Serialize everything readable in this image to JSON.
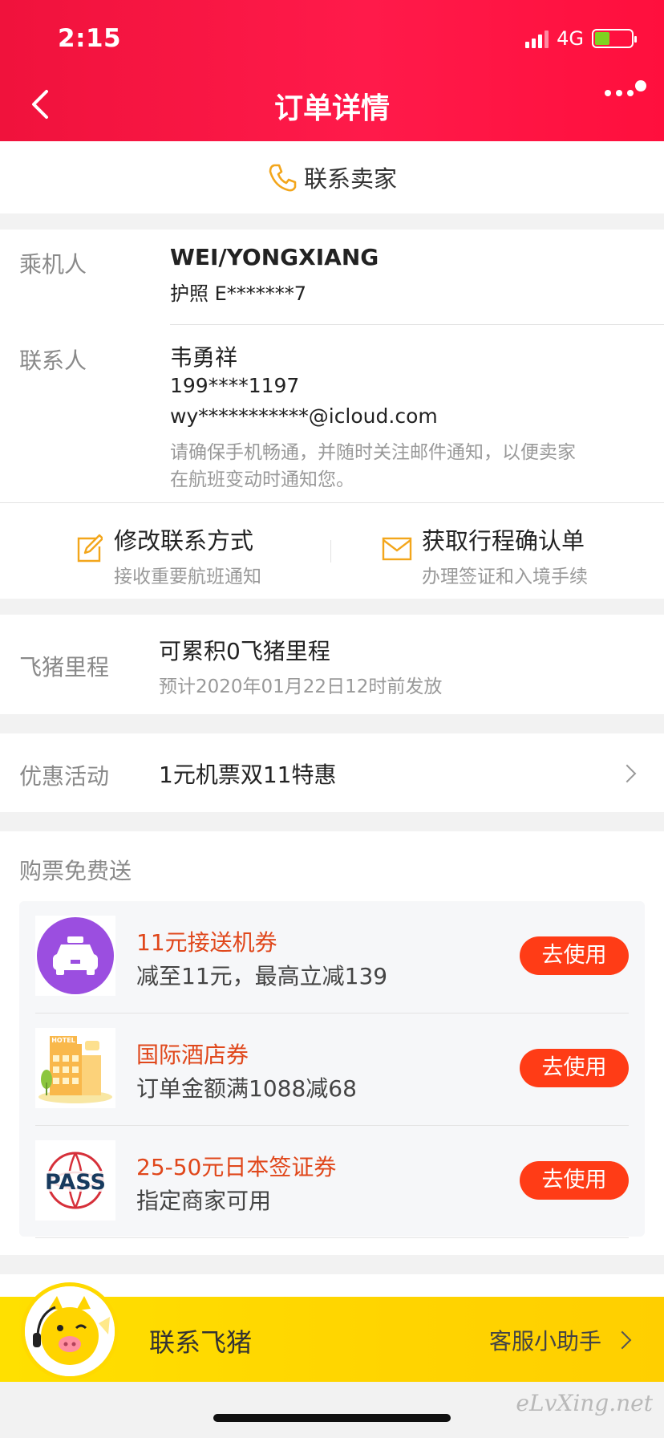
{
  "status_bar": {
    "time": "2:15",
    "network": "4G"
  },
  "header": {
    "title": "订单详情"
  },
  "contact_seller": {
    "label": "联系卖家"
  },
  "passenger": {
    "label": "乘机人",
    "name": "WEI/YONGXIANG",
    "document": "护照 E*******7"
  },
  "contact": {
    "label": "联系人",
    "name": "韦勇祥",
    "phone": "199****1197",
    "email": "wy***********@icloud.com",
    "notice_line1": "请确保手机畅通，并随时关注邮件通知，以便卖家",
    "notice_line2": "在航班变动时通知您。"
  },
  "actions": [
    {
      "title": "修改联系方式",
      "desc": "接收重要航班通知",
      "icon": "edit-icon"
    },
    {
      "title": "获取行程确认单",
      "desc": "办理签证和入境手续",
      "icon": "mail-icon"
    }
  ],
  "mileage": {
    "label": "飞猪里程",
    "value": "可累积0飞猪里程",
    "note": "预计2020年01月22日12时前发放"
  },
  "promotion": {
    "label": "优惠活动",
    "value": "1元机票双11特惠"
  },
  "gifts": {
    "label": "购票免费送",
    "coupons": [
      {
        "title": "11元接送机券",
        "desc": "减至11元，最高立减139",
        "button": "去使用",
        "icon": "taxi-icon"
      },
      {
        "title": "国际酒店券",
        "desc": "订单金额满1088减68",
        "button": "去使用",
        "icon": "hotel-icon",
        "icon_text": "HOTEL"
      },
      {
        "title": "25-50元日本签证券",
        "desc": "指定商家可用",
        "button": "去使用",
        "icon": "pass-icon",
        "icon_text": "PASS"
      }
    ]
  },
  "fliggy_bar": {
    "title": "联系飞猪",
    "assistant": "客服小助手"
  },
  "watermark": "eLvXing.net",
  "colors": {
    "header_red": "#ff1a4a",
    "coupon_orange": "#ff3c16",
    "fliggy_yellow": "#ffd900",
    "taxi_purple": "#9b4ee0"
  }
}
